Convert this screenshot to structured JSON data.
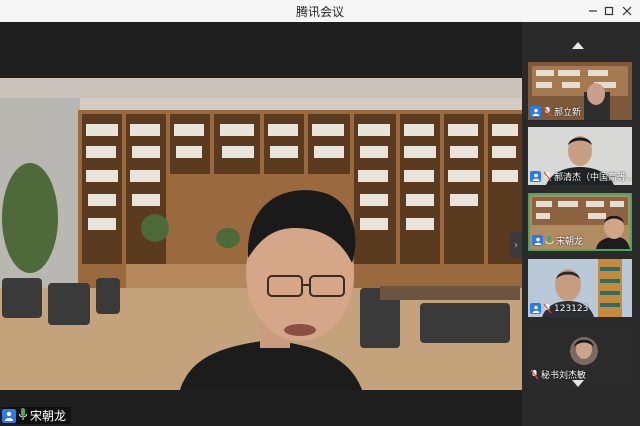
{
  "window": {
    "title": "腾讯会议",
    "controls": [
      "minimize-icon",
      "maximize-icon",
      "close-icon"
    ]
  },
  "main_video": {
    "speaker_name": "宋朝龙"
  },
  "participants": [
    {
      "name": "郝立新",
      "mic": "muted",
      "active": false
    },
    {
      "name": "郝清杰（中国高等...",
      "mic": "muted",
      "active": false
    },
    {
      "name": "宋朝龙",
      "mic": "speaking",
      "active": true
    },
    {
      "name": "123123",
      "mic": "muted",
      "active": false
    },
    {
      "name": "秘书刘杰敏",
      "mic": "muted",
      "active": false
    }
  ],
  "colors": {
    "accent_blue": "#2f7be5",
    "speaking_green": "#4da45c",
    "muted_red": "#e24c3f"
  }
}
